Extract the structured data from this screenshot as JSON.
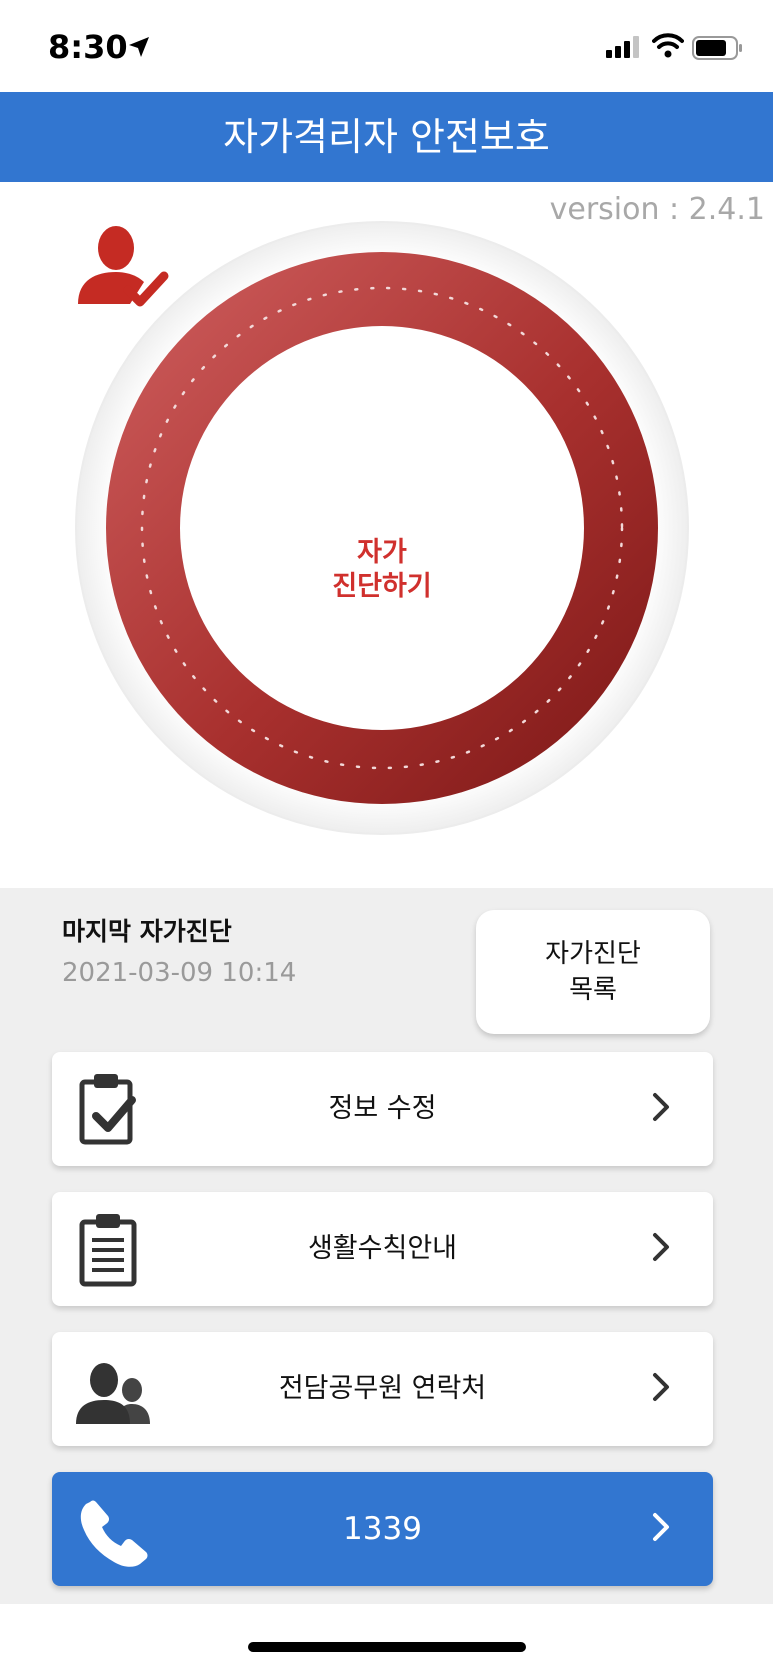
{
  "status_bar": {
    "time": "8:30"
  },
  "header": {
    "title": "자가격리자 안전보호"
  },
  "version": "version : 2.4.1",
  "diagnosis": {
    "line1": "자가",
    "line2": "진단하기"
  },
  "last_diagnosis": {
    "title": "마지막 자가진단",
    "date": "2021-03-09 10:14"
  },
  "diagnosis_list_button": {
    "line1": "자가진단",
    "line2": "목록"
  },
  "menu": [
    {
      "label": "정보 수정",
      "icon": "clipboard-check-icon"
    },
    {
      "label": "생활수칙안내",
      "icon": "clipboard-list-icon"
    },
    {
      "label": "전담공무원 연락처",
      "icon": "people-icon"
    },
    {
      "label": "1339",
      "icon": "phone-icon"
    }
  ],
  "colors": {
    "accent_blue": "#3276d0",
    "ring_red": "#a8302e",
    "label_red": "#d0302d"
  }
}
